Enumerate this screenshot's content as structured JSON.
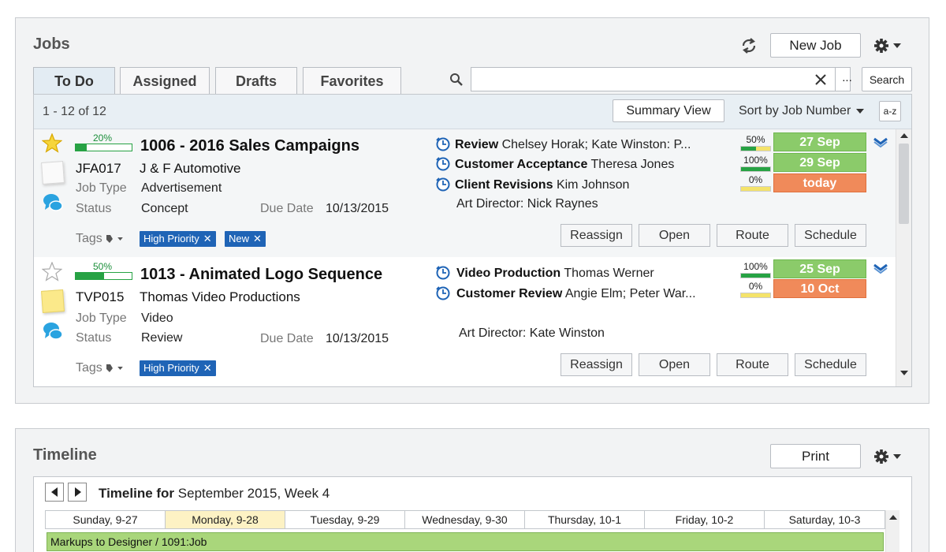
{
  "jobs_panel": {
    "title": "Jobs",
    "new_job_label": "New Job",
    "tabs": [
      {
        "label": "To Do"
      },
      {
        "label": "Assigned"
      },
      {
        "label": "Drafts"
      },
      {
        "label": "Favorites"
      }
    ],
    "search": {
      "value": "",
      "placeholder": "",
      "more_label": "...",
      "search_label": "Search"
    },
    "list": {
      "count_text": "1 - 12 of 12",
      "summary_view_label": "Summary View",
      "sort_label": "Sort by Job Number",
      "az_label": "a-z"
    },
    "jobs": [
      {
        "percent_label": "20%",
        "percent_value": 20,
        "starred": true,
        "title": "1006 - 2016 Sales Campaigns",
        "code": "JFA017",
        "client": "J & F Automotive",
        "job_type_label": "Job Type",
        "job_type": "Advertisement",
        "status_label": "Status",
        "status": "Concept",
        "due_label": "Due Date",
        "due_date": "10/13/2015",
        "tags_label": "Tags",
        "tags": [
          "High Priority",
          "New"
        ],
        "tasks": [
          {
            "name": "Review",
            "people": "Chelsey Horak; Kate Winston: P...",
            "pct_label": "50%",
            "pct": 50,
            "date": "27 Sep",
            "state": "green"
          },
          {
            "name": "Customer Acceptance",
            "people": "Theresa Jones",
            "pct_label": "100%",
            "pct": 100,
            "date": "29 Sep",
            "state": "green"
          },
          {
            "name": "Client Revisions",
            "people": "Kim Johnson",
            "pct_label": "0%",
            "pct": 0,
            "date": "today",
            "state": "orange"
          }
        ],
        "art_director": "Art Director: Nick Raynes",
        "actions": [
          "Reassign",
          "Open",
          "Route",
          "Schedule"
        ]
      },
      {
        "percent_label": "50%",
        "percent_value": 50,
        "starred": false,
        "title": "1013 - Animated Logo Sequence",
        "code": "TVP015",
        "client": "Thomas Video Productions",
        "job_type_label": "Job Type",
        "job_type": "Video",
        "status_label": "Status",
        "status": "Review",
        "due_label": "Due Date",
        "due_date": "10/13/2015",
        "tags_label": "Tags",
        "tags": [
          "High Priority"
        ],
        "tasks": [
          {
            "name": "Video Production",
            "people": "Thomas Werner",
            "pct_label": "100%",
            "pct": 100,
            "date": "25 Sep",
            "state": "green"
          },
          {
            "name": "Customer Review",
            "people": "Angie Elm; Peter War...",
            "pct_label": "0%",
            "pct": 0,
            "date": "10 Oct",
            "state": "orange"
          }
        ],
        "art_director": "Art Director: Kate Winston",
        "actions": [
          "Reassign",
          "Open",
          "Route",
          "Schedule"
        ]
      }
    ]
  },
  "timeline_panel": {
    "title": "Timeline",
    "print_label": "Print",
    "heading_bold": "Timeline for",
    "heading_rest": " September 2015, Week 4",
    "days": [
      "Sunday, 9-27",
      "Monday, 9-28",
      "Tuesday, 9-29",
      "Wednesday, 9-30",
      "Thursday, 10-1",
      "Friday, 10-2",
      "Saturday, 10-3"
    ],
    "today_index": 1,
    "bar_label": "Markups to Designer / 1091:Job"
  },
  "colors": {
    "tag_blue": "#1f64b6",
    "progress_green": "#27a244",
    "date_green": "#8bcb6a",
    "date_orange": "#f08a5a",
    "today_yellow": "#fdf2c4",
    "timeline_bar": "#a9d67b"
  },
  "icons": {
    "refresh": "refresh-icon",
    "gear": "gear-icon",
    "search": "search-icon",
    "clear": "close-icon",
    "star": "star-icon",
    "note": "sticky-note-icon",
    "chat": "chat-bubble-icon",
    "tag": "tag-icon",
    "clock": "clock-icon",
    "expand": "chevron-down-icon"
  }
}
